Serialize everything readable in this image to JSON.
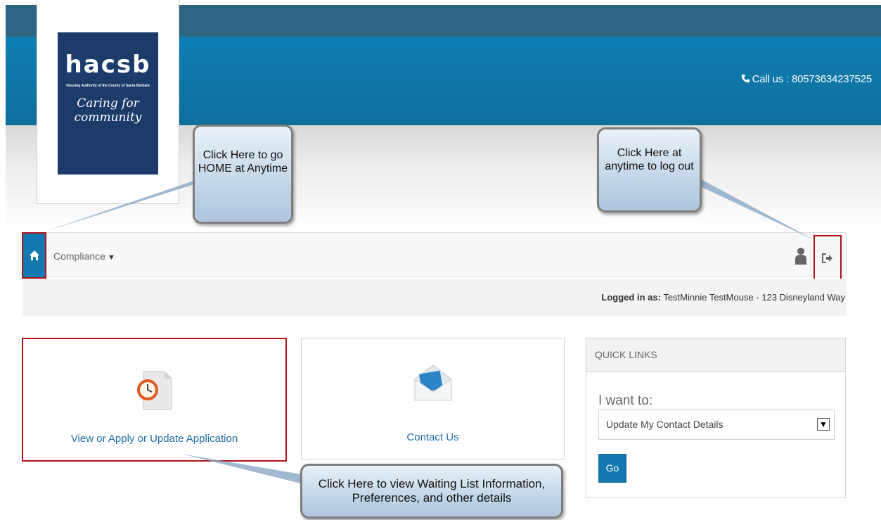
{
  "header": {
    "phone_text": "Call us : 80573634237525"
  },
  "logo": {
    "brand": "hacsb",
    "subtitle": "Housing Authority of the County of Santa Barbara",
    "tagline": "Caring for community"
  },
  "nav": {
    "home_icon": "home-icon",
    "menu_compliance": "Compliance",
    "user_icon": "user-icon",
    "logout_icon": "logout-icon"
  },
  "session": {
    "logged_in_label": "Logged in as:",
    "logged_in_value": "TestMinnie TestMouse - 123 Disneyland Way"
  },
  "tiles": [
    {
      "label": "View or Apply or Update Application",
      "icon": "document-clock-icon"
    },
    {
      "label": "Contact Us",
      "icon": "envelope-icon"
    }
  ],
  "quick_links": {
    "title": "QUICK LINKS",
    "prompt": "I want to:",
    "selected": "Update My Contact Details",
    "go_label": "Go"
  },
  "callouts": {
    "home": "Click Here to go HOME at Anytime",
    "logout": "Click Here at anytime to log out",
    "waiting": "Click Here to view Waiting List Information, Preferences, and other details"
  },
  "colors": {
    "header_dark": "#2e6582",
    "header_blue": "#0f7fb2",
    "accent": "#1479b3",
    "highlight_border": "#b0121a",
    "link": "#1d6fa5"
  }
}
